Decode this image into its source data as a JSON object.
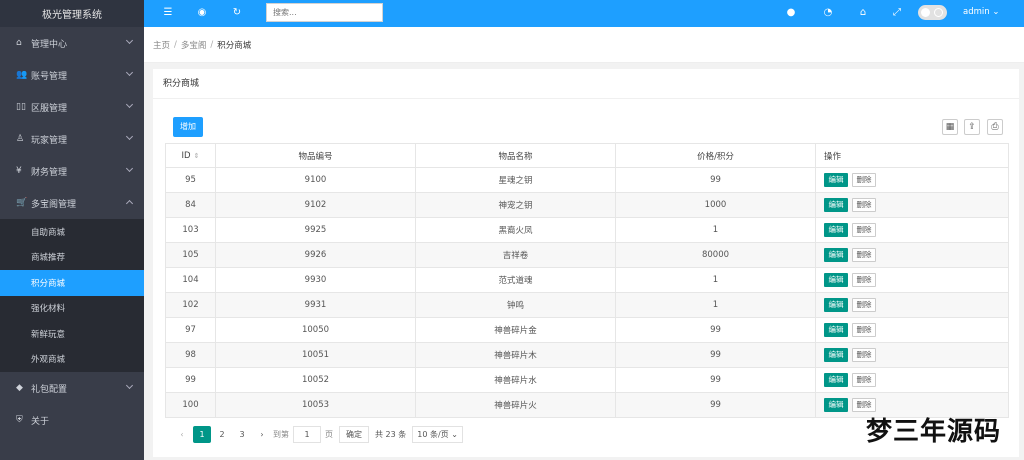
{
  "app": {
    "title": "极光管理系统"
  },
  "header": {
    "search_placeholder": "搜索...",
    "user": "admin"
  },
  "sidebar": {
    "items": [
      {
        "label": "管理中心",
        "icon": "home-icon",
        "glyph": "⌂"
      },
      {
        "label": "账号管理",
        "icon": "users-icon",
        "glyph": "👥"
      },
      {
        "label": "区服管理",
        "icon": "server-icon",
        "glyph": "▯▯"
      },
      {
        "label": "玩家管理",
        "icon": "user-icon",
        "glyph": "♙"
      },
      {
        "label": "财务管理",
        "icon": "finance-icon",
        "glyph": "¥"
      },
      {
        "label": "多宝阁管理",
        "icon": "cart-icon",
        "glyph": "🛒"
      },
      {
        "label": "礼包配置",
        "icon": "gift-icon",
        "glyph": "◆"
      },
      {
        "label": "关于",
        "icon": "shield-icon",
        "glyph": "⛨"
      }
    ],
    "sub_items": [
      "自助商城",
      "商城推荐",
      "积分商城",
      "强化材料",
      "新鲜玩意",
      "外观商城"
    ]
  },
  "breadcrumb": [
    "主页",
    "多宝阁",
    "积分商城"
  ],
  "card": {
    "title": "积分商城",
    "add_label": "增加"
  },
  "table": {
    "headers": [
      "ID",
      "物品编号",
      "物品名称",
      "价格/积分",
      "操作"
    ],
    "rows": [
      [
        "95",
        "9100",
        "星魂之钥",
        "99"
      ],
      [
        "84",
        "9102",
        "神宠之钥",
        "1000"
      ],
      [
        "103",
        "9925",
        "黑裔火凤",
        "1"
      ],
      [
        "105",
        "9926",
        "吉祥卷",
        "80000"
      ],
      [
        "104",
        "9930",
        "范式道魂",
        "1"
      ],
      [
        "102",
        "9931",
        "钟鸣",
        "1"
      ],
      [
        "97",
        "10050",
        "神兽碎片金",
        "99"
      ],
      [
        "98",
        "10051",
        "神兽碎片木",
        "99"
      ],
      [
        "99",
        "10052",
        "神兽碎片水",
        "99"
      ],
      [
        "100",
        "10053",
        "神兽碎片火",
        "99"
      ]
    ],
    "edit_label": "编辑",
    "delete_label": "删除"
  },
  "pager": {
    "pages": [
      "1",
      "2",
      "3"
    ],
    "goto_label": "到第",
    "goto_value": "1",
    "page_unit": "页",
    "confirm": "确定",
    "total": "共 23 条",
    "page_size": "10 条/页"
  },
  "watermark": "梦三年源码"
}
